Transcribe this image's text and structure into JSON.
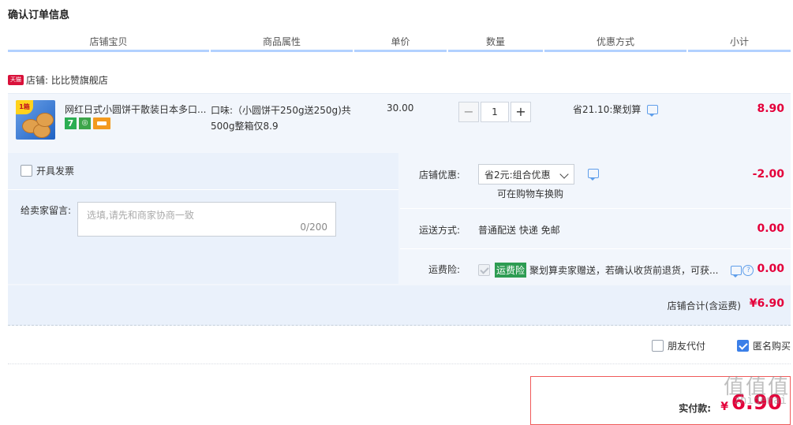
{
  "page": {
    "title": "确认订单信息"
  },
  "table_headers": [
    "店铺宝贝",
    "商品属性",
    "单价",
    "数量",
    "优惠方式",
    "小计"
  ],
  "shop": {
    "badge": "天猫",
    "label": "店铺: 比比赞旗舰店"
  },
  "item": {
    "thumb_badge": "1箱",
    "name": "网红日式小圆饼干散装日本多口...",
    "service_icons": [
      "seven-day-return-icon",
      "shield-icon",
      "card-icon"
    ],
    "service_icon_text": {
      "seven": "7"
    },
    "attributes": "口味:（小圆饼干250g送250g)共500g整箱仅8.9",
    "price": "30.00",
    "quantity": "1",
    "qty_minus": "−",
    "qty_plus": "+",
    "discount": "省21.10:聚划算",
    "subtotal": "8.90"
  },
  "options": {
    "invoice_label": "开具发票",
    "message_label": "给卖家留言:",
    "message_placeholder": "选填,请先和商家协商一致",
    "message_count": "0/200",
    "shop_discount_label": "店铺优惠:",
    "shop_discount_value": "省2元:组合优惠",
    "shop_discount_link": "可在购物车换购",
    "shop_discount_amount": "-2.00",
    "shipping_label": "运送方式:",
    "shipping_value": "普通配送 快递 免邮",
    "shipping_amount": "0.00",
    "insurance_label": "运费险:",
    "insurance_tag": "运费险",
    "insurance_text": "聚划算卖家赠送，若确认收货前退货，可获...",
    "insurance_amount": "0.00",
    "shop_total_label": "店铺合计(含运费)",
    "shop_total_amount": "¥6.90"
  },
  "footer": {
    "friend_pay_label": "朋友代付",
    "anonymous_label": "匿名购买",
    "actual_pay_label": "实付款:",
    "currency": "¥",
    "actual_pay_amount": "6.90"
  },
  "watermark": {
    "text": "值值值",
    "domain": "zhidemai"
  },
  "colors": {
    "accent_red": "#e4003a",
    "header_line": "#b2d1ff",
    "row_bg": "#f2f6fc",
    "checkbox_on": "#3b7fe8"
  }
}
